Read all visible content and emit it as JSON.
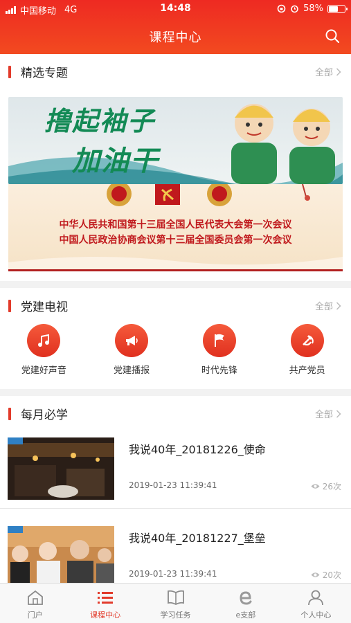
{
  "status_bar": {
    "carrier": "中国移动",
    "network": "4G",
    "time": "14:48",
    "battery": "58%",
    "battery_level": 0.58
  },
  "nav": {
    "title": "课程中心",
    "search_icon": "search-icon"
  },
  "featured": {
    "title": "精选专题",
    "more_label": "全部",
    "banner1": {
      "slogan_line1": "撸起袖子",
      "slogan_line2": "加油干"
    },
    "banner2": {
      "line1": "中华人民共和国第十三届全国人民代表大会第一次会议",
      "line2": "中国人民政治协商会议第十三届全国委员会第一次会议"
    }
  },
  "party_tv": {
    "title": "党建电视",
    "more_label": "全部",
    "items": [
      {
        "label": "党建好声音",
        "icon": "music-note-icon"
      },
      {
        "label": "党建播报",
        "icon": "megaphone-icon"
      },
      {
        "label": "时代先锋",
        "icon": "flag-icon"
      },
      {
        "label": "共产党员",
        "icon": "party-emblem-icon"
      }
    ]
  },
  "monthly": {
    "title": "每月必学",
    "more_label": "全部",
    "items": [
      {
        "title": "我说40年_20181226_使命",
        "date": "2019-01-23 11:39:41",
        "views": "26次"
      },
      {
        "title": "我说40年_20181227_堡垒",
        "date": "2019-01-23 11:39:41",
        "views": "20次"
      }
    ]
  },
  "tabbar": {
    "items": [
      {
        "label": "门户",
        "icon": "home-icon"
      },
      {
        "label": "课程中心",
        "icon": "list-icon",
        "active": true
      },
      {
        "label": "学习任务",
        "icon": "book-icon"
      },
      {
        "label": "e支部",
        "icon": "e-branch-icon"
      },
      {
        "label": "个人中心",
        "icon": "user-icon"
      }
    ]
  },
  "colors": {
    "primary": "#e23b2b",
    "header": "#ee2a22",
    "slogan_green": "#138a55"
  }
}
